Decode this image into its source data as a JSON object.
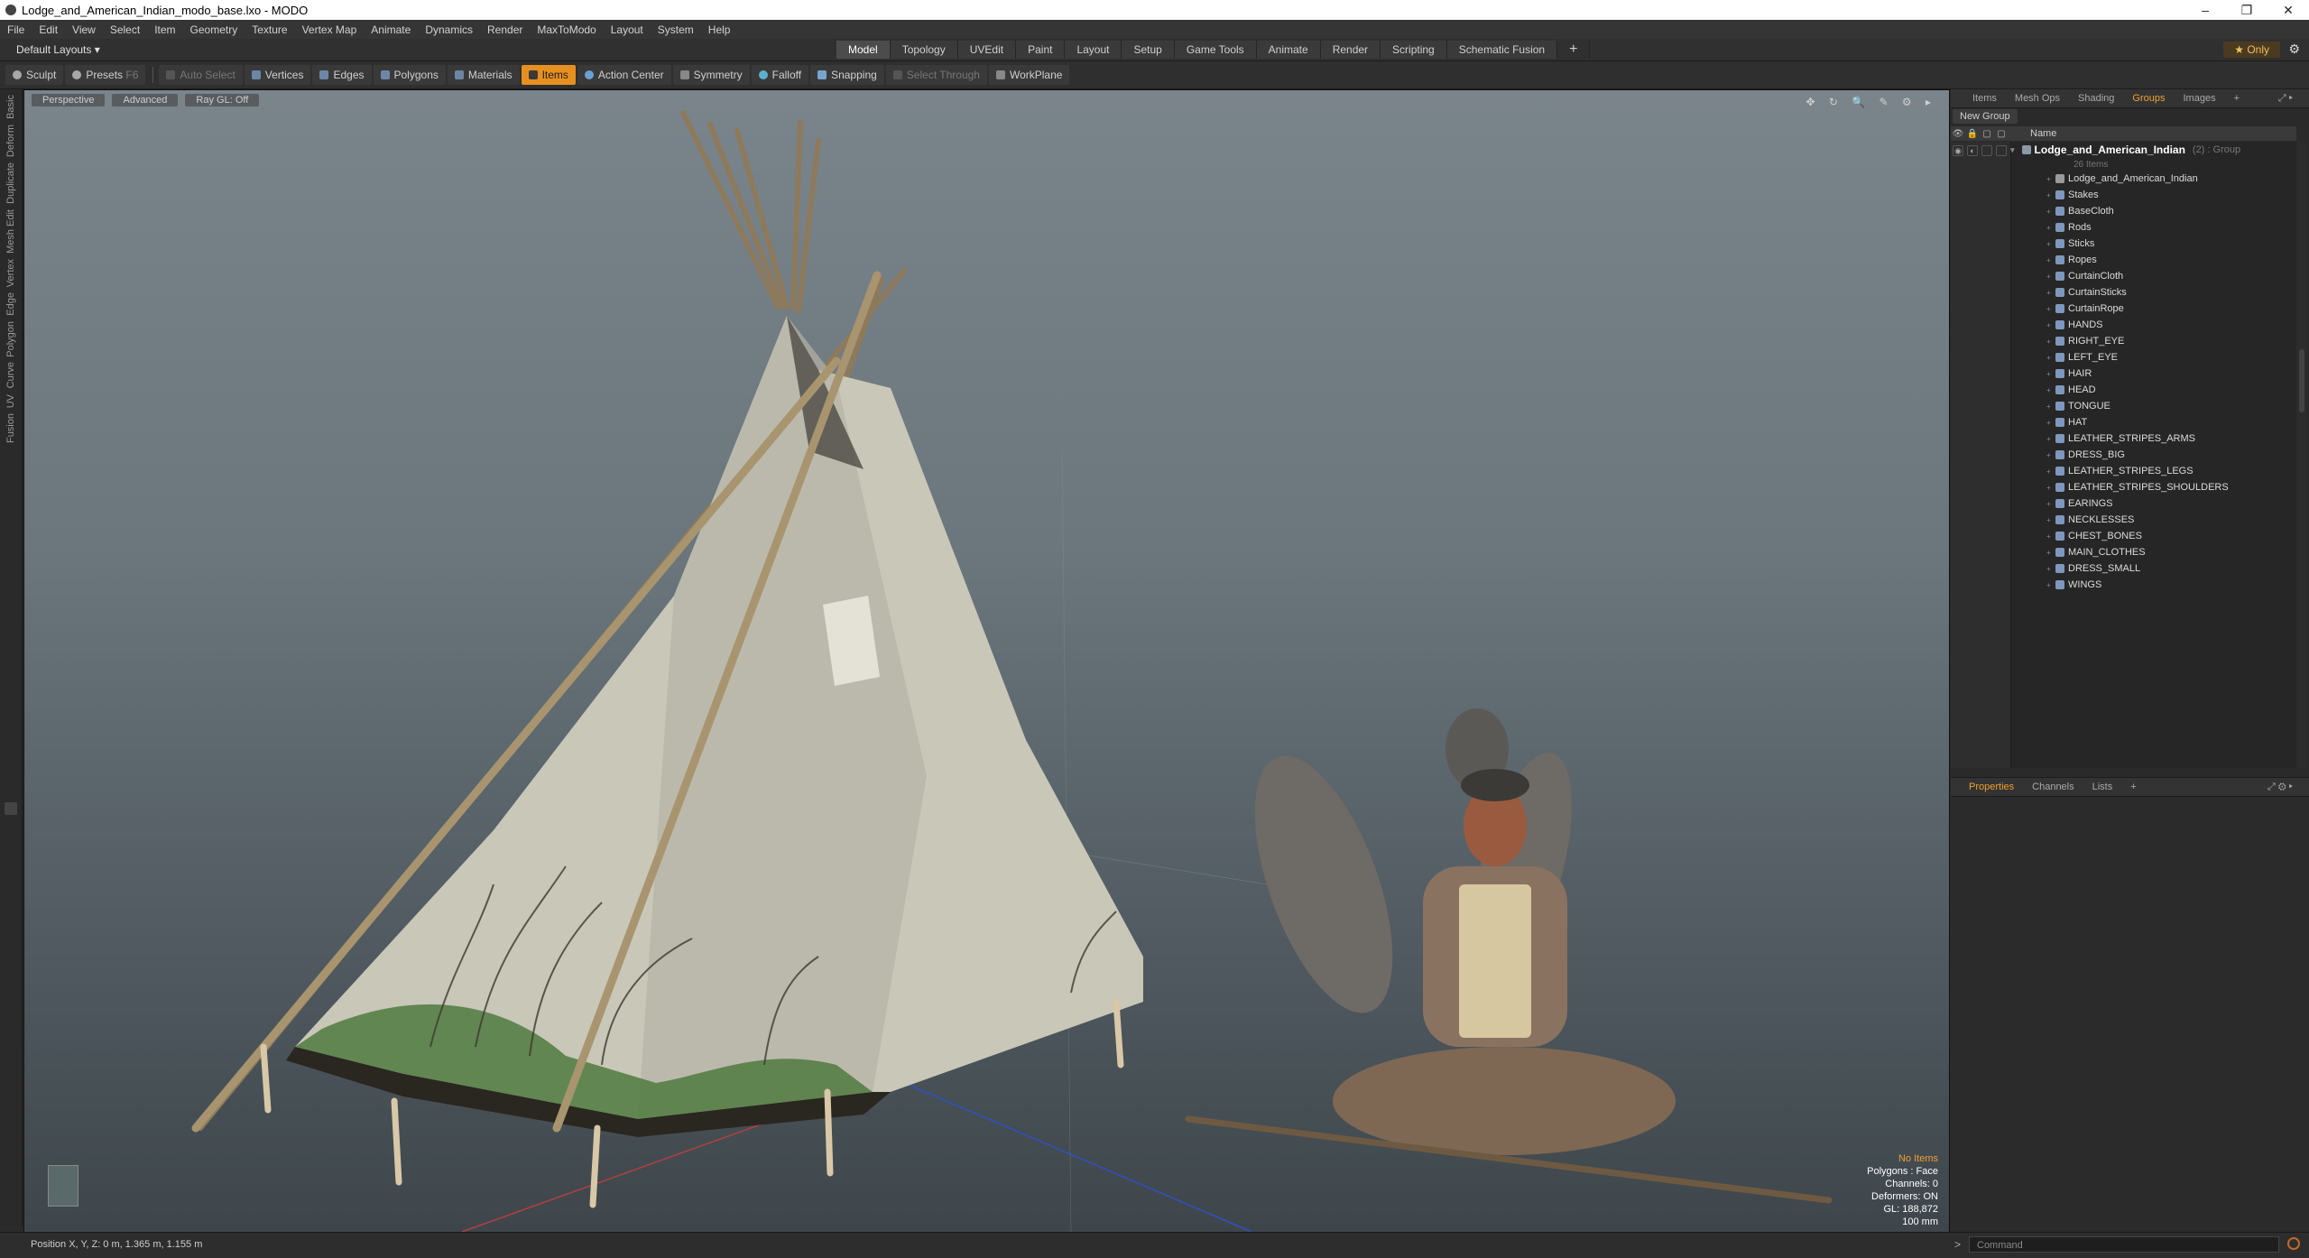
{
  "window": {
    "title": "Lodge_and_American_Indian_modo_base.lxo - MODO",
    "controls": [
      "–",
      "❐",
      "✕"
    ]
  },
  "menu": [
    "File",
    "Edit",
    "View",
    "Select",
    "Item",
    "Geometry",
    "Texture",
    "Vertex Map",
    "Animate",
    "Dynamics",
    "Render",
    "MaxToModo",
    "Layout",
    "System",
    "Help"
  ],
  "layoutbar": {
    "layouts_label": "Default Layouts ▾",
    "tabs": [
      "Model",
      "Topology",
      "UVEdit",
      "Paint",
      "Layout",
      "Setup",
      "Game Tools",
      "Animate",
      "Render",
      "Scripting",
      "Schematic Fusion"
    ],
    "active_tab": "Model",
    "add_tab": "+",
    "only_label": "★ Only",
    "gear": "⚙"
  },
  "toolbar": {
    "sculpt": "Sculpt",
    "presets": "Presets",
    "presets_key": "F6",
    "auto_select": "Auto Select",
    "vertices": "Vertices",
    "edges": "Edges",
    "polygons": "Polygons",
    "materials": "Materials",
    "items": "Items",
    "action_center": "Action Center",
    "symmetry": "Symmetry",
    "falloff": "Falloff",
    "snapping": "Snapping",
    "select_through": "Select Through",
    "workplane": "WorkPlane"
  },
  "left_tabs": [
    "Basic",
    "Deform",
    "Duplicate",
    "Mesh Edit",
    "Vertex",
    "Edge",
    "Polygon",
    "Curve",
    "UV",
    "Fusion"
  ],
  "viewport": {
    "view_mode": "Perspective",
    "shading": "Advanced",
    "raygl": "Ray GL: Off",
    "icons": "✥ ↻ 🔍 ✎ ⚙ ▸",
    "stats": {
      "no_items": "No Items",
      "polygons": "Polygons : Face",
      "channels": "Channels: 0",
      "deformers": "Deformers: ON",
      "gl": "GL: 188,872",
      "scale": "100 mm"
    }
  },
  "statusbar": {
    "position": "Position X, Y, Z:   0 m, 1.365 m, 1.155 m",
    "command_arrow": ">",
    "command_placeholder": "Command"
  },
  "right_panel": {
    "tabs": [
      "Items",
      "Mesh Ops",
      "Shading",
      "Groups",
      "Images",
      "+"
    ],
    "active_tab": "Groups",
    "new_group": "New Group",
    "list_header": {
      "name": "Name"
    },
    "group": {
      "name": "Lodge_and_American_Indian",
      "suffix": "(2) : Group",
      "count": "26 Items"
    },
    "items": [
      "Lodge_and_American_Indian",
      "Stakes",
      "BaseCloth",
      "Rods",
      "Sticks",
      "Ropes",
      "CurtainCloth",
      "CurtainSticks",
      "CurtainRope",
      "HANDS",
      "RIGHT_EYE",
      "LEFT_EYE",
      "HAIR",
      "HEAD",
      "TONGUE",
      "HAT",
      "LEATHER_STRIPES_ARMS",
      "DRESS_BIG",
      "LEATHER_STRIPES_LEGS",
      "LEATHER_STRIPES_SHOULDERS",
      "EARINGS",
      "NECKLESSES",
      "CHEST_BONES",
      "MAIN_CLOTHES",
      "DRESS_SMALL",
      "WINGS"
    ],
    "properties_tabs": [
      "Properties",
      "Channels",
      "Lists",
      "+"
    ],
    "properties_active": "Properties"
  },
  "colors": {
    "accent": "#f0a030",
    "items_button": "#e8901f",
    "mesh_icon": "#7e98bd"
  }
}
